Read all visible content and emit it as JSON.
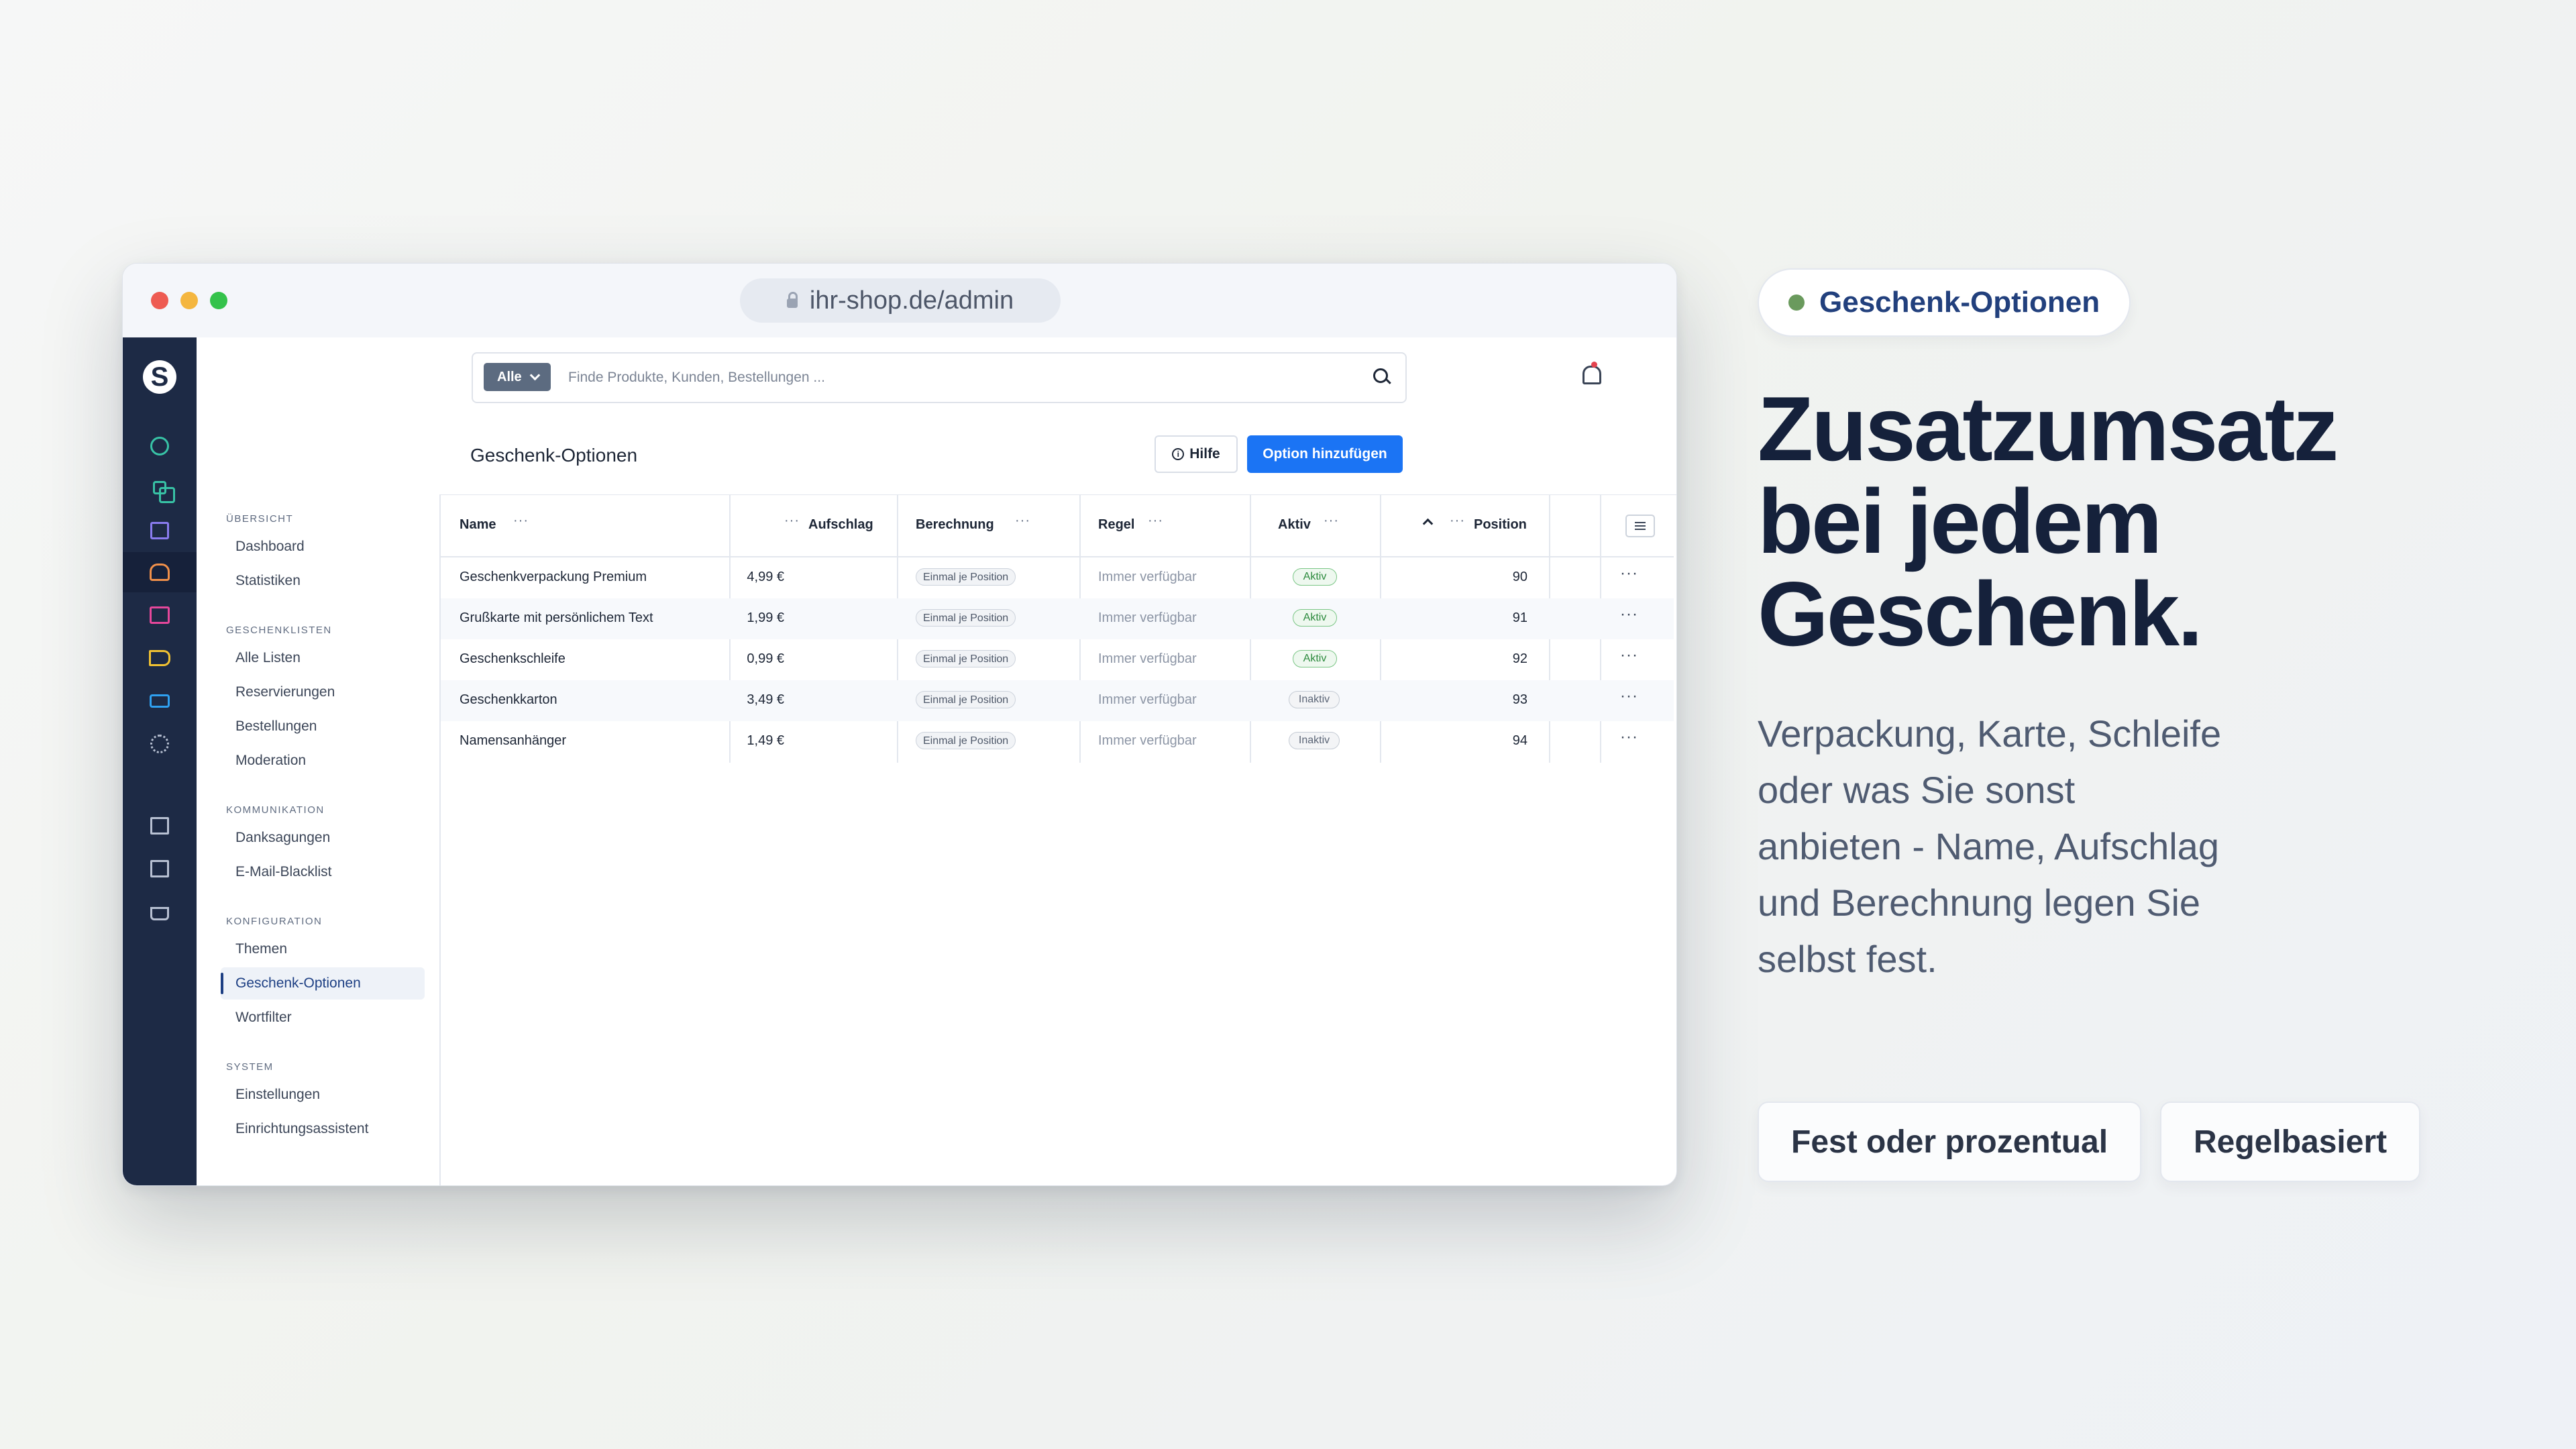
{
  "browser": {
    "url": "ihr-shop.de/admin"
  },
  "topbar": {
    "search_type": "Alle",
    "search_placeholder": "Finde Produkte, Kunden, Bestellungen ..."
  },
  "rail": {
    "logo": "S"
  },
  "page": {
    "title": "Geschenk-Optionen",
    "help_label": "Hilfe",
    "add_label": "Option hinzufügen"
  },
  "nav": {
    "groups": [
      {
        "title": "ÜBERSICHT",
        "items": [
          "Dashboard",
          "Statistiken"
        ]
      },
      {
        "title": "GESCHENKLISTEN",
        "items": [
          "Alle Listen",
          "Reservierungen",
          "Bestellungen",
          "Moderation"
        ]
      },
      {
        "title": "KOMMUNIKATION",
        "items": [
          "Danksagungen",
          "E-Mail-Blacklist"
        ]
      },
      {
        "title": "KONFIGURATION",
        "items": [
          "Themen",
          "Geschenk-Optionen",
          "Wortfilter"
        ]
      },
      {
        "title": "SYSTEM",
        "items": [
          "Einstellungen",
          "Einrichtungsassistent"
        ]
      }
    ],
    "active": "Geschenk-Optionen"
  },
  "table": {
    "columns": {
      "name": "Name",
      "surcharge": "Aufschlag",
      "calc": "Berechnung",
      "rule": "Regel",
      "active": "Aktiv",
      "position": "Position"
    },
    "dots": "···",
    "rows": [
      {
        "name": "Geschenkverpackung Premium",
        "surcharge": "4,99 €",
        "calc": "Einmal je Position",
        "rule": "Immer verfügbar",
        "active": "Aktiv",
        "position": "90",
        "more": "···"
      },
      {
        "name": "Grußkarte mit persönlichem Text",
        "surcharge": "1,99 €",
        "calc": "Einmal je Position",
        "rule": "Immer verfügbar",
        "active": "Aktiv",
        "position": "91",
        "more": "···"
      },
      {
        "name": "Geschenkschleife",
        "surcharge": "0,99 €",
        "calc": "Einmal je Position",
        "rule": "Immer verfügbar",
        "active": "Aktiv",
        "position": "92",
        "more": "···"
      },
      {
        "name": "Geschenkkarton",
        "surcharge": "3,49 €",
        "calc": "Einmal je Position",
        "rule": "Immer verfügbar",
        "active": "Inaktiv",
        "position": "93",
        "more": "···"
      },
      {
        "name": "Namensanhänger",
        "surcharge": "1,49 €",
        "calc": "Einmal je Position",
        "rule": "Immer verfügbar",
        "active": "Inaktiv",
        "position": "94",
        "more": "···"
      }
    ]
  },
  "hero": {
    "pill": "Geschenk-Optionen",
    "headline": [
      "Zusatzumsatz",
      "bei jedem",
      "Geschenk."
    ],
    "sub": "Verpackung, Karte, Schleife oder was Sie sonst anbieten - Name, Aufschlag und Berechnung legen Sie selbst fest.",
    "cta": [
      "Fest oder prozentual",
      "Regelbasiert"
    ]
  },
  "colors": {
    "accent": "#1b74f4",
    "rail": "#1d2a45",
    "active_green": "#2c8a3d",
    "headline": "#15213b"
  },
  "icons": [
    "lock-icon",
    "search-icon",
    "bell-icon",
    "info-icon",
    "gauge-icon",
    "copy-icon",
    "bag-icon",
    "users-icon",
    "list-icon",
    "megaphone-icon",
    "plug-icon",
    "gear-icon",
    "store-icon",
    "basket-icon",
    "columns-icon",
    "sort-up-icon"
  ]
}
